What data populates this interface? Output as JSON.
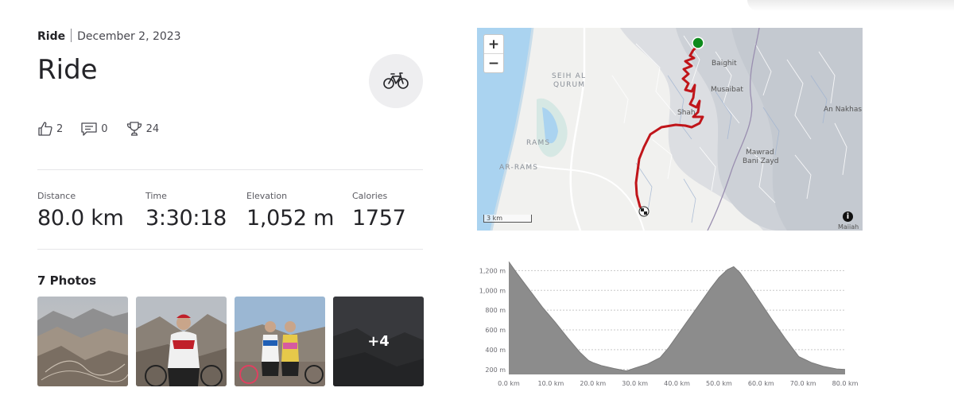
{
  "activity": {
    "type": "Ride",
    "date": "December 2, 2023",
    "title": "Ride",
    "sport_icon": "bike-icon"
  },
  "social": {
    "kudos": "2",
    "comments": "0",
    "achievements": "24"
  },
  "stats": [
    {
      "label": "Distance",
      "value": "80.0 km"
    },
    {
      "label": "Time",
      "value": "3:30:18"
    },
    {
      "label": "Elevation",
      "value": "1,052 m"
    },
    {
      "label": "Calories",
      "value": "1757"
    }
  ],
  "photos": {
    "heading": "7 Photos",
    "more_label": "+4"
  },
  "map": {
    "zoom_in": "+",
    "zoom_out": "−",
    "scale": "3 km",
    "info": "i",
    "places": {
      "baighit": "Baighit",
      "musaibat": "Musaibat",
      "shah": "Shah",
      "an_nakhas": "An Nakhas",
      "mawrad": "Mawrad",
      "bani_zayd": "Bani Zayd",
      "seih_al": "SEIH AL",
      "qurum": "QURUM",
      "rams": "RAMS",
      "ar_rams": "AR-RAMS",
      "maiiah": "Maiiah"
    }
  },
  "chart_data": {
    "type": "area",
    "title": "",
    "xlabel": "",
    "ylabel": "",
    "xlim": [
      0,
      80
    ],
    "ylim": [
      150,
      1300
    ],
    "x_ticks": [
      "0.0 km",
      "10.0 km",
      "20.0 km",
      "30.0 km",
      "40.0 km",
      "50.0 km",
      "60.0 km",
      "70.0 km",
      "80.0 km"
    ],
    "y_ticks": [
      "1,200 m",
      "1,000 m",
      "800 m",
      "600 m",
      "400 m",
      "200 m"
    ],
    "grid": true,
    "series": [
      {
        "x": [
          0,
          2,
          5,
          8,
          11,
          14,
          17,
          19,
          20,
          22,
          25,
          28,
          30,
          33,
          36,
          38,
          40,
          42,
          44,
          46,
          48,
          50,
          52,
          53.5,
          55,
          57,
          60,
          63,
          66,
          69,
          72,
          75,
          78,
          80
        ],
        "y": [
          1290,
          1170,
          1000,
          830,
          680,
          520,
          370,
          290,
          270,
          240,
          210,
          185,
          215,
          255,
          320,
          420,
          540,
          660,
          780,
          900,
          1020,
          1130,
          1210,
          1240,
          1180,
          1060,
          870,
          680,
          500,
          330,
          270,
          230,
          205,
          200
        ]
      }
    ],
    "color": "#8c8c8c"
  }
}
